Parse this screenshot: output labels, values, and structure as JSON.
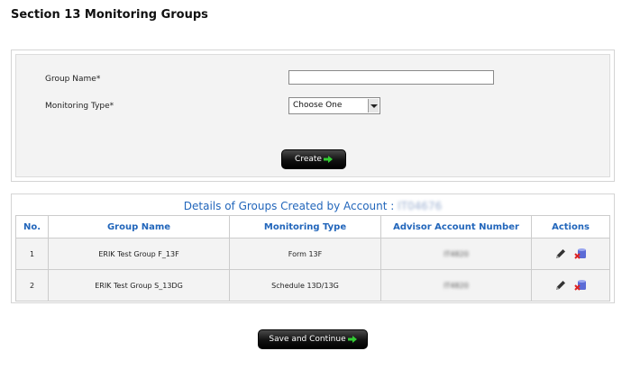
{
  "page": {
    "title": "Section 13 Monitoring Groups"
  },
  "form": {
    "group_name_label": "Group Name*",
    "group_name_value": "",
    "monitoring_type_label": "Monitoring Type*",
    "monitoring_type_selected": "Choose One",
    "create_button": "Create"
  },
  "groups_table": {
    "title": "Details of Groups Created by Account :",
    "account_id": "IT04676",
    "columns": [
      "No.",
      "Group Name",
      "Monitoring Type",
      "Advisor Account Number",
      "Actions"
    ],
    "rows": [
      {
        "no": "1",
        "group_name": "ERIK Test Group F_13F",
        "monitoring_type": "Form 13F",
        "advisor_account": "IT4820"
      },
      {
        "no": "2",
        "group_name": "ERIK Test Group S_13DG",
        "monitoring_type": "Schedule 13D/13G",
        "advisor_account": "IT4820"
      }
    ]
  },
  "footer": {
    "save_button": "Save and Continue"
  },
  "icons": {
    "edit": "pencil-icon",
    "delete": "delete-database-icon",
    "arrow": "green-arrow-icon"
  },
  "colors": {
    "heading_blue": "#2266bb",
    "button_dark": "#111111",
    "arrow_green": "#33cc33"
  }
}
